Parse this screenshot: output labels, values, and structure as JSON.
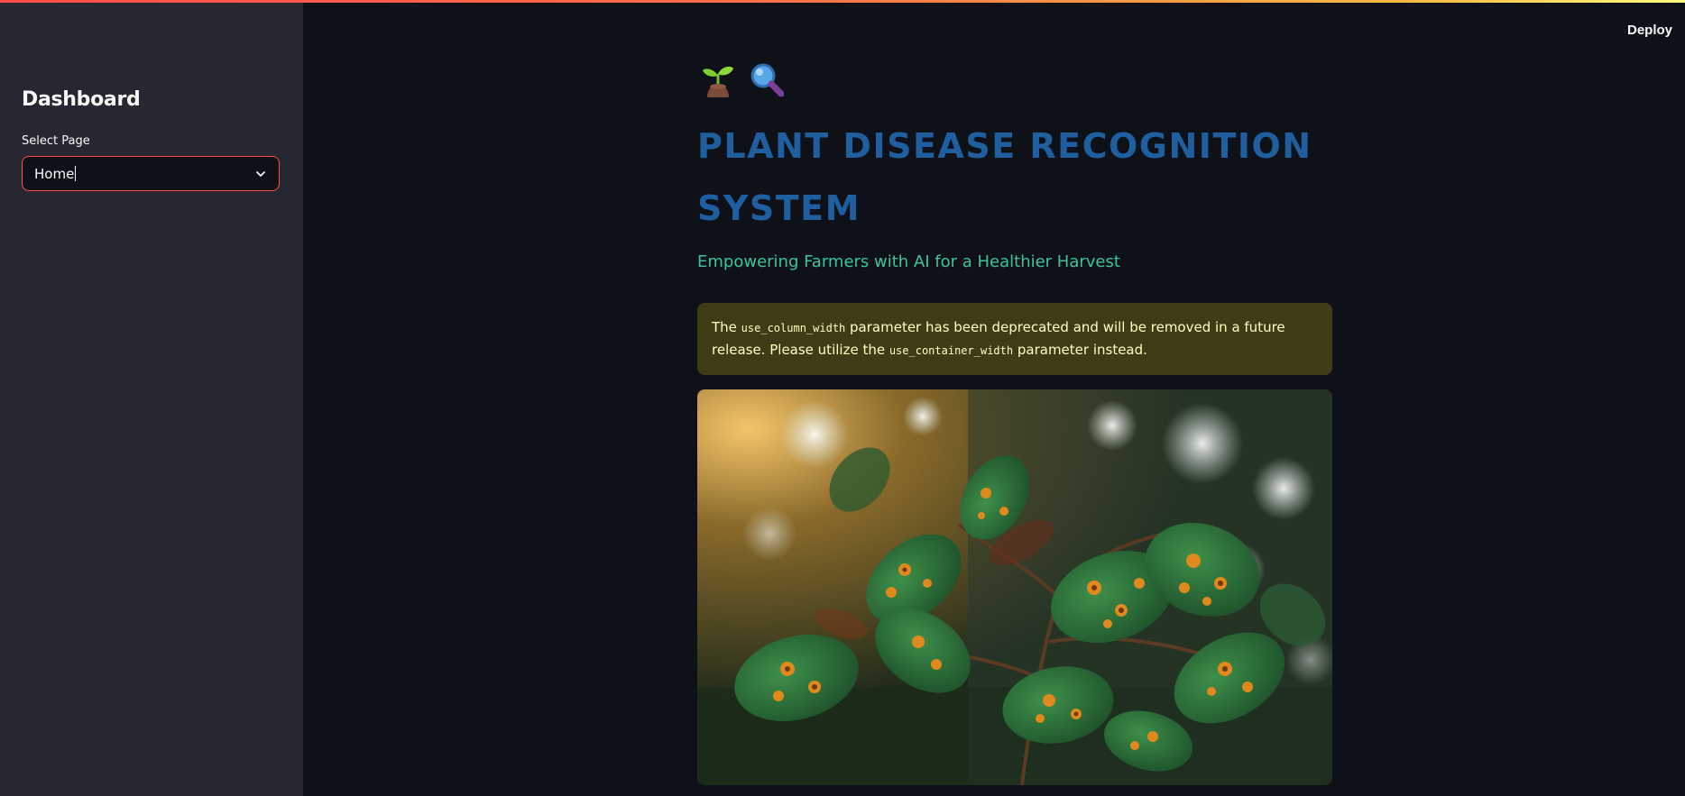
{
  "header": {
    "deploy_label": "Deploy"
  },
  "sidebar": {
    "title": "Dashboard",
    "select_label": "Select Page",
    "select_value": "Home"
  },
  "main": {
    "emojis": [
      "seedling",
      "magnifying-glass"
    ],
    "title": "PLANT DISEASE RECOGNITION SYSTEM",
    "subtitle": "Empowering Farmers with AI for a Healthier Harvest",
    "warning": {
      "prefix": "The ",
      "code1": "use_column_width",
      "middle": " parameter has been deprecated and will be removed in a future release. Please utilize the ",
      "code2": "use_container_width",
      "suffix": " parameter instead."
    }
  },
  "colors": {
    "background": "#0e1117",
    "sidebar": "#262730",
    "title": "#1f5e9f",
    "subtitle": "#3bc49a",
    "warning_bg": "#3e3b16",
    "warning_text": "#ffffc2",
    "accent": "#ff4b4b"
  }
}
